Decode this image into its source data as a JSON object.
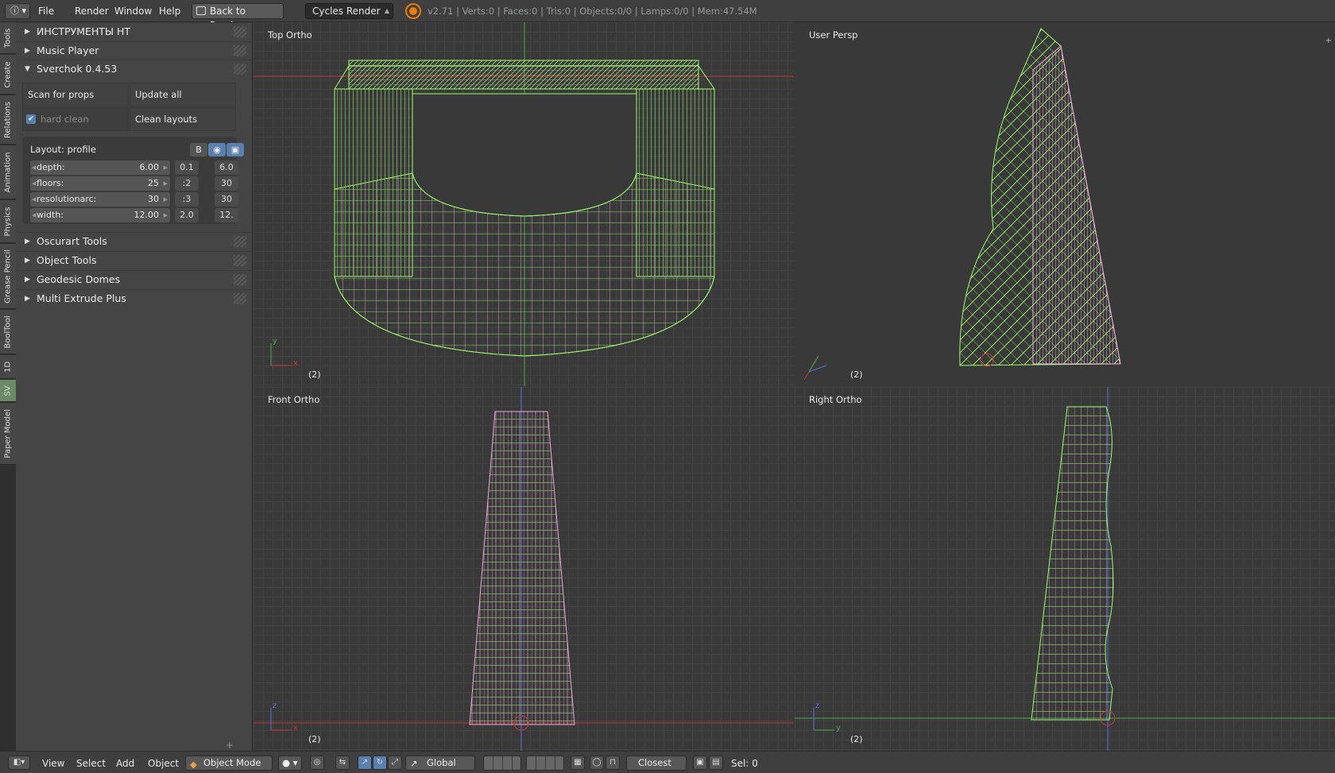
{
  "topbar": {
    "info_icon": "info-icon",
    "menus": [
      "File",
      "Render",
      "Window",
      "Help"
    ],
    "back_button": "Back to Previous",
    "render_engine": "Cycles Render",
    "stats": "v2.71 | Verts:0 | Faces:0 | Tris:0 | Objects:0/0 | Lamps:0/0 | Mem:47.54M"
  },
  "tool_tabs": [
    "Tools",
    "Create",
    "Relations",
    "Animation",
    "Physics",
    "Grease Pencil",
    "BoolTool",
    "1D",
    "SV",
    "Paper Model"
  ],
  "active_tab": "SV",
  "panels": {
    "instrumenty": "ИНСТРУМЕНТЫ НТ",
    "music_player": "Music Player",
    "sverchok": "Sverchok 0.4.53",
    "oscurart": "Oscurart Tools",
    "object_tools": "Object Tools",
    "geodesic": "Geodesic Domes",
    "multi_extrude": "Multi Extrude Plus"
  },
  "sverchok": {
    "scan_button": "Scan for props",
    "update_button": "Update all",
    "hard_clean_label": "hard clean",
    "hard_clean_checked": true,
    "clean_button": "Clean layouts",
    "layout_label": "Layout: profile",
    "layout_b": "B",
    "props": [
      {
        "name": "depth:",
        "value": "6.00",
        "min": "0.1",
        "max": "6.0"
      },
      {
        "name": "floors:",
        "value": "25",
        "min": ":2",
        "max": "30"
      },
      {
        "name": "resolutionarc:",
        "value": "30",
        "min": ":3",
        "max": "30"
      },
      {
        "name": "width:",
        "value": "12.00",
        "min": "2.0",
        "max": "12."
      }
    ]
  },
  "viewports": {
    "top": {
      "label": "Top Ortho",
      "count": "(2)"
    },
    "persp": {
      "label": "User Persp",
      "count": "(2)"
    },
    "front": {
      "label": "Front Ortho",
      "count": "(2)"
    },
    "right": {
      "label": "Right Ortho",
      "count": "(2)"
    }
  },
  "axis_letters": {
    "x": "x",
    "y": "y",
    "z": "z"
  },
  "bottombar": {
    "menus": [
      "View",
      "Select",
      "Add",
      "Object"
    ],
    "mode": "Object Mode",
    "orientation": "Global",
    "snap": "Closest",
    "sel": "Sel: 0"
  },
  "colors": {
    "wire_green": "#9dfc6c",
    "wire_pink": "#f0a8e0",
    "x_axis": "#c23a3a",
    "y_axis": "#4fa84f",
    "active_tab": "#6a8a66"
  }
}
